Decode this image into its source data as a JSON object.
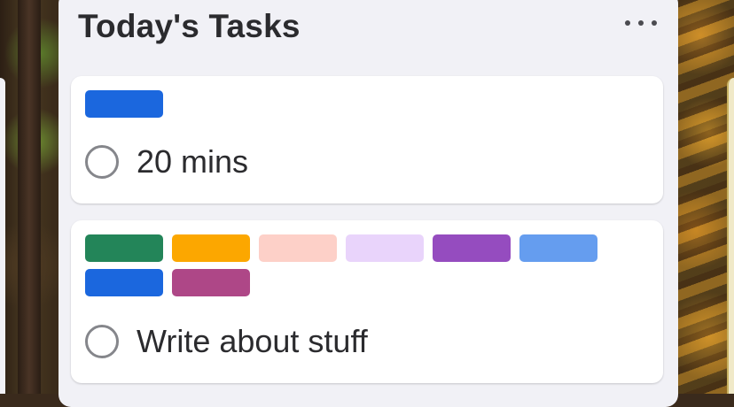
{
  "list": {
    "title": "Today's Tasks",
    "more_icon": "ellipsis-icon"
  },
  "cards": [
    {
      "title": "20 mins",
      "labels": [
        "#1b67de"
      ]
    },
    {
      "title": "Write about stuff",
      "labels": [
        "#238559",
        "#fca700",
        "#fdd0c8",
        "#e9d4fb",
        "#954cbf",
        "#659def",
        "#1b67de",
        "#ae4787"
      ]
    }
  ]
}
